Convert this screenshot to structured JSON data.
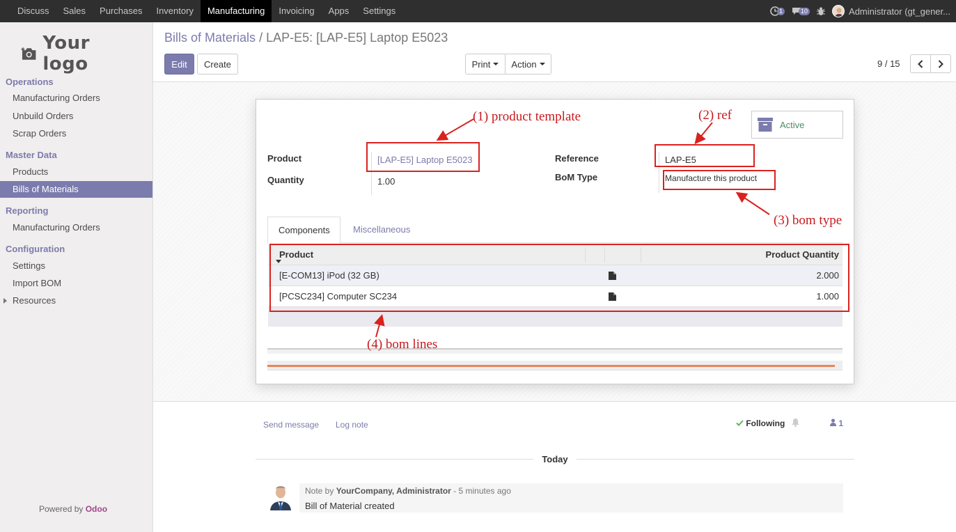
{
  "topbar": {
    "menu": [
      "Discuss",
      "Sales",
      "Purchases",
      "Inventory",
      "Manufacturing",
      "Invoicing",
      "Apps",
      "Settings"
    ],
    "active_menu": "Manufacturing",
    "activity_count": "1",
    "message_count": "10",
    "user": "Administrator (gt_gener..."
  },
  "sidebar": {
    "logo_text": "Your logo",
    "sections": [
      {
        "title": "Operations",
        "items": [
          "Manufacturing Orders",
          "Unbuild Orders",
          "Scrap Orders"
        ]
      },
      {
        "title": "Master Data",
        "items": [
          "Products",
          "Bills of Materials"
        ]
      },
      {
        "title": "Reporting",
        "items": [
          "Manufacturing Orders"
        ]
      },
      {
        "title": "Configuration",
        "items": [
          "Settings",
          "Import BOM",
          "Resources"
        ]
      }
    ],
    "active_item": "Bills of Materials",
    "powered_prefix": "Powered by",
    "powered_brand": "Odoo"
  },
  "control_panel": {
    "breadcrumb_parent": "Bills of Materials",
    "breadcrumb_sep": "/",
    "breadcrumb_current": "LAP-E5: [LAP-E5] Laptop E5023",
    "edit_label": "Edit",
    "create_label": "Create",
    "print_label": "Print",
    "action_label": "Action",
    "pager": "9 / 15"
  },
  "form": {
    "active_label": "Active",
    "product_label": "Product",
    "product_value": "[LAP-E5] Laptop E5023",
    "quantity_label": "Quantity",
    "quantity_value": "1.00",
    "reference_label": "Reference",
    "reference_value": "LAP-E5",
    "bom_type_label": "BoM Type",
    "bom_type_value": "Manufacture this product",
    "tabs": [
      "Components",
      "Miscellaneous"
    ],
    "table": {
      "headers": [
        "Product",
        "Product Quantity"
      ],
      "rows": [
        {
          "product": "[E-COM13] iPod (32 GB)",
          "qty": "2.000"
        },
        {
          "product": "[PCSC234] Computer SC234",
          "qty": "1.000"
        }
      ]
    }
  },
  "annotations": {
    "a1": "(1) product template",
    "a2": "(2) ref",
    "a3": "(3) bom type",
    "a4": "(4) bom lines"
  },
  "chatter": {
    "send_message": "Send message",
    "log_note": "Log note",
    "following": "Following",
    "followers_count": "1",
    "day": "Today",
    "note_prefix": "Note by",
    "note_author": "YourCompany, Administrator",
    "note_time": "- 5 minutes ago",
    "note_body": "Bill of Material created"
  },
  "colors": {
    "brand": "#7c7bad",
    "annotation": "#d9221e",
    "topbar": "#2f2f2f"
  }
}
